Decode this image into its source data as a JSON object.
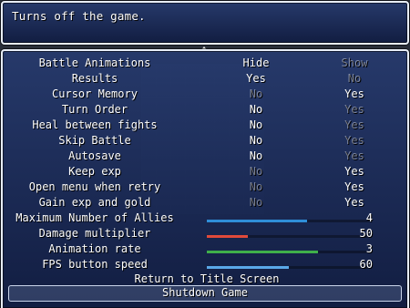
{
  "help": {
    "text": "Turns off the game."
  },
  "options": [
    {
      "label": "Battle Animations",
      "a": "Hide",
      "b": "Show",
      "active": "a"
    },
    {
      "label": "Results",
      "a": "Yes",
      "b": "No",
      "active": "a"
    },
    {
      "label": "Cursor Memory",
      "a": "No",
      "b": "Yes",
      "active": "b"
    },
    {
      "label": "Turn Order",
      "a": "No",
      "b": "Yes",
      "active": "a"
    },
    {
      "label": "Heal between fights",
      "a": "No",
      "b": "Yes",
      "active": "a"
    },
    {
      "label": "Skip Battle",
      "a": "No",
      "b": "Yes",
      "active": "a"
    },
    {
      "label": "Autosave",
      "a": "No",
      "b": "Yes",
      "active": "a"
    },
    {
      "label": "Keep exp",
      "a": "No",
      "b": "Yes",
      "active": "b"
    },
    {
      "label": "Open menu when retry",
      "a": "No",
      "b": "Yes",
      "active": "b"
    },
    {
      "label": "Gain exp and gold",
      "a": "No",
      "b": "Yes",
      "active": "b"
    }
  ],
  "gauges": [
    {
      "label": "Maximum Number of Allies",
      "value": "4",
      "level": 0.61,
      "color": "#2f8ed8"
    },
    {
      "label": "Damage multiplier",
      "value": "50",
      "level": 0.25,
      "color": "#e04a3a"
    },
    {
      "label": "Animation rate",
      "value": "3",
      "level": 0.68,
      "color": "#3fb04a"
    },
    {
      "label": "FPS button speed",
      "value": "60",
      "level": 0.5,
      "color": "#5aa8e8"
    }
  ],
  "commands": {
    "return_title": "Return to Title Screen",
    "shutdown": "Shutdown Game"
  }
}
